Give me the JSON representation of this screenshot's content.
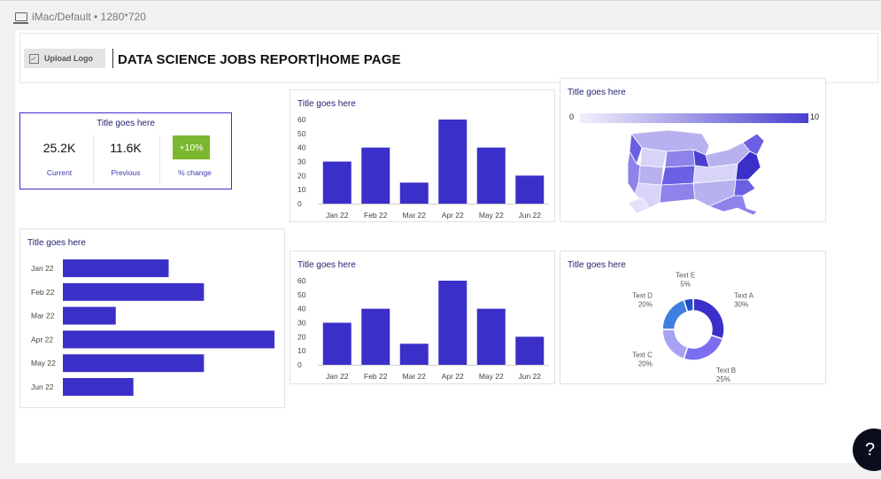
{
  "device": {
    "label": "iMac/Default • 1280*720"
  },
  "header": {
    "upload_logo_label": "Upload Logo",
    "title": "DATA SCIENCE JOBS REPORT|HOME PAGE"
  },
  "kpi": {
    "title": "Title goes here",
    "current_value": "25.2K",
    "current_label": "Current",
    "previous_value": "11.6K",
    "previous_label": "Previous",
    "change_value": "+10%",
    "change_label": "% change",
    "change_color": "#7cb82f"
  },
  "map": {
    "title": "Title goes here",
    "scale_min": "0",
    "scale_max": "10"
  },
  "bar_chart_top": {
    "title": "Title goes here"
  },
  "bar_chart_bottom": {
    "title": "Title goes here"
  },
  "hbar_chart": {
    "title": "Title goes here"
  },
  "donut_chart": {
    "title": "Title goes here"
  },
  "colors": {
    "accent": "#3c2ec9",
    "bar": "#3b2fc9"
  },
  "help": {
    "label": "?"
  },
  "chart_data": [
    {
      "type": "bar",
      "categories": [
        "Jan 22",
        "Feb 22",
        "Mar 22",
        "Apr 22",
        "May 22",
        "Jun 22"
      ],
      "values": [
        30,
        40,
        15,
        60,
        40,
        20
      ],
      "yticks": [
        0,
        10,
        20,
        30,
        40,
        50,
        60
      ],
      "ylim": [
        0,
        60
      ]
    },
    {
      "type": "bar",
      "categories": [
        "Jan 22",
        "Feb 22",
        "Mar 22",
        "Apr 22",
        "May 22",
        "Jun 22"
      ],
      "values": [
        30,
        40,
        15,
        60,
        40,
        20
      ],
      "yticks": [
        0,
        10,
        20,
        30,
        40,
        50,
        60
      ],
      "ylim": [
        0,
        60
      ]
    },
    {
      "type": "bar",
      "orientation": "horizontal",
      "categories": [
        "Jan 22",
        "Feb 22",
        "Mar 22",
        "Apr 22",
        "May 22",
        "Jun 22"
      ],
      "values": [
        30,
        40,
        15,
        60,
        40,
        20
      ],
      "xlim": [
        0,
        60
      ]
    },
    {
      "type": "pie",
      "donut": true,
      "slices": [
        {
          "label": "Text A",
          "value": 30,
          "pct": "30%",
          "color": "#3b2fc9"
        },
        {
          "label": "Text B",
          "value": 25,
          "pct": "25%",
          "color": "#7b6ff0"
        },
        {
          "label": "Text C",
          "value": 20,
          "pct": "20%",
          "color": "#a8a2f5"
        },
        {
          "label": "Text D",
          "value": 20,
          "pct": "20%",
          "color": "#3f7fe0"
        },
        {
          "label": "Text E",
          "value": 5,
          "pct": "5%",
          "color": "#1e4fc2"
        }
      ]
    }
  ]
}
